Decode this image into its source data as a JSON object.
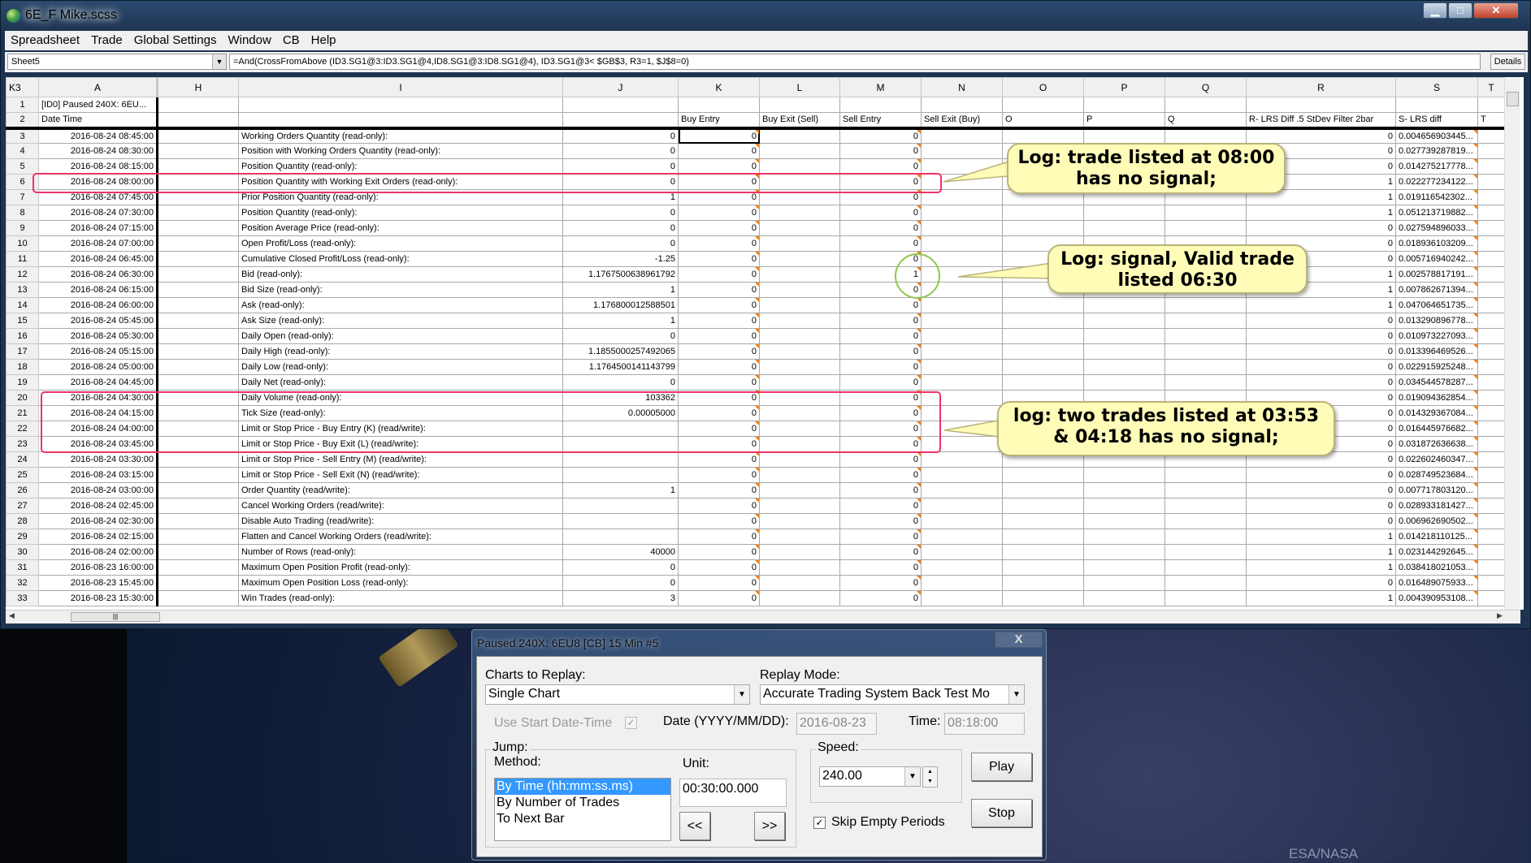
{
  "window": {
    "title": "6E_F Mike.scss",
    "minimize": "▁",
    "maximize": "□",
    "close": "✕"
  },
  "menu": [
    "Spreadsheet",
    "Trade",
    "Global Settings",
    "Window",
    "CB",
    "Help"
  ],
  "formula_bar": {
    "sheet": "Sheet5",
    "formula": "=And(CrossFromAbove (ID3.SG1@3:ID3.SG1@4,ID8.SG1@3:ID8.SG1@4), ID3.SG1@3< $GB$3, R3=1, $J$8=0)",
    "details_label": "Details"
  },
  "grid": {
    "cell_ref": "K3",
    "columns": [
      "A",
      "H",
      "I",
      "J",
      "K",
      "L",
      "M",
      "N",
      "O",
      "P",
      "Q",
      "R",
      "S",
      "T"
    ],
    "row1": {
      "num": "1",
      "A": "[ID0] Paused 240X: 6EU..."
    },
    "row2": {
      "num": "2",
      "A": "Date Time",
      "K": "Buy Entry",
      "L": "Buy Exit (Sell)",
      "M": "Sell Entry",
      "N": "Sell Exit (Buy)",
      "O": "O",
      "P": "P",
      "Q": "Q",
      "R": "R- LRS Diff .5 StDev Filter 2bar",
      "S": "S- LRS diff",
      "T": "T"
    },
    "rows": [
      [
        "3",
        "2016-08-24  08:45:00",
        "Working Orders Quantity (read-only):",
        "0",
        "0",
        "0",
        "0",
        "0.004656903445..."
      ],
      [
        "4",
        "2016-08-24  08:30:00",
        "Position with Working Orders Quantity (read-only):",
        "0",
        "0",
        "0",
        "0",
        "0.027739287819..."
      ],
      [
        "5",
        "2016-08-24  08:15:00",
        "Position Quantity (read-only):",
        "0",
        "0",
        "0",
        "0",
        "0.014275217778..."
      ],
      [
        "6",
        "2016-08-24  08:00:00",
        "Position Quantity with Working Exit Orders (read-only):",
        "0",
        "0",
        "0",
        "1",
        "0.022277234122..."
      ],
      [
        "7",
        "2016-08-24  07:45:00",
        "Prior Position Quantity (read-only):",
        "1",
        "0",
        "0",
        "1",
        "0.019116542302..."
      ],
      [
        "8",
        "2016-08-24  07:30:00",
        "Position Quantity (read-only):",
        "0",
        "0",
        "0",
        "1",
        "0.051213719882..."
      ],
      [
        "9",
        "2016-08-24  07:15:00",
        "Position Average Price (read-only):",
        "0",
        "0",
        "0",
        "0",
        "0.027594896033..."
      ],
      [
        "10",
        "2016-08-24  07:00:00",
        "Open Profit/Loss (read-only):",
        "0",
        "0",
        "0",
        "0",
        "0.018936103209..."
      ],
      [
        "11",
        "2016-08-24  06:45:00",
        "Cumulative Closed Profit/Loss (read-only):",
        "-1.25",
        "0",
        "0",
        "0",
        "0.005716940242..."
      ],
      [
        "12",
        "2016-08-24  06:30:00",
        "Bid (read-only):",
        "1.1767500638961792",
        "0",
        "1",
        "1",
        "0.002578817191..."
      ],
      [
        "13",
        "2016-08-24  06:15:00",
        "Bid Size (read-only):",
        "1",
        "0",
        "0",
        "1",
        "0.007862671394..."
      ],
      [
        "14",
        "2016-08-24  06:00:00",
        "Ask (read-only):",
        "1.176800012588501",
        "0",
        "0",
        "1",
        "0.047064651735..."
      ],
      [
        "15",
        "2016-08-24  05:45:00",
        "Ask Size (read-only):",
        "1",
        "0",
        "0",
        "0",
        "0.013290896778..."
      ],
      [
        "16",
        "2016-08-24  05:30:00",
        "Daily Open (read-only):",
        "0",
        "0",
        "0",
        "0",
        "0.010973227093..."
      ],
      [
        "17",
        "2016-08-24  05:15:00",
        "Daily High (read-only):",
        "1.1855000257492065",
        "0",
        "0",
        "0",
        "0.013396469526..."
      ],
      [
        "18",
        "2016-08-24  05:00:00",
        "Daily Low (read-only):",
        "1.1764500141143799",
        "0",
        "0",
        "0",
        "0.022915925248..."
      ],
      [
        "19",
        "2016-08-24  04:45:00",
        "Daily Net (read-only):",
        "0",
        "0",
        "0",
        "0",
        "0.034544578287..."
      ],
      [
        "20",
        "2016-08-24  04:30:00",
        "Daily Volume (read-only):",
        "103362",
        "0",
        "0",
        "0",
        "0.019094362854..."
      ],
      [
        "21",
        "2016-08-24  04:15:00",
        "Tick Size (read-only):",
        "0.00005000",
        "0",
        "0",
        "0",
        "0.014329367084..."
      ],
      [
        "22",
        "2016-08-24  04:00:00",
        "Limit or Stop Price - Buy Entry (K) (read/write):",
        "",
        "0",
        "0",
        "0",
        "0.016445976682..."
      ],
      [
        "23",
        "2016-08-24  03:45:00",
        "Limit or Stop Price - Buy Exit (L) (read/write):",
        "",
        "0",
        "0",
        "0",
        "0.031872636638..."
      ],
      [
        "24",
        "2016-08-24  03:30:00",
        "Limit or Stop Price - Sell Entry (M) (read/write):",
        "",
        "0",
        "0",
        "0",
        "0.022602460347..."
      ],
      [
        "25",
        "2016-08-24  03:15:00",
        "Limit or Stop Price - Sell Exit (N) (read/write):",
        "",
        "0",
        "0",
        "0",
        "0.028749523684..."
      ],
      [
        "26",
        "2016-08-24  03:00:00",
        "Order Quantity (read/write):",
        "1",
        "0",
        "0",
        "0",
        "0.007717803120..."
      ],
      [
        "27",
        "2016-08-24  02:45:00",
        "Cancel Working Orders (read/write):",
        "",
        "0",
        "0",
        "0",
        "0.028933181427..."
      ],
      [
        "28",
        "2016-08-24  02:30:00",
        "Disable Auto Trading (read/write):",
        "",
        "0",
        "0",
        "0",
        "0.006962690502..."
      ],
      [
        "29",
        "2016-08-24  02:15:00",
        "Flatten and Cancel Working Orders (read/write):",
        "",
        "0",
        "0",
        "1",
        "0.014218110125..."
      ],
      [
        "30",
        "2016-08-24  02:00:00",
        "Number of Rows (read-only):",
        "40000",
        "0",
        "0",
        "1",
        "0.023144292645..."
      ],
      [
        "31",
        "2016-08-23  16:00:00",
        "Maximum Open Position Profit (read-only):",
        "0",
        "0",
        "0",
        "1",
        "0.038418021053..."
      ],
      [
        "32",
        "2016-08-23  15:45:00",
        "Maximum Open Position Loss (read-only):",
        "0",
        "0",
        "0",
        "0",
        "0.016489075933..."
      ],
      [
        "33",
        "2016-08-23  15:30:00",
        "Win Trades (read-only):",
        "3",
        "0",
        "0",
        "1",
        "0.004390953108..."
      ]
    ]
  },
  "annotations": {
    "callout1": {
      "line1": "Log: trade listed at 08:00",
      "line2": "has no signal;"
    },
    "callout2": {
      "line1": "Log: signal, Valid trade",
      "line2": "listed 06:30"
    },
    "callout3": {
      "line1": "log: two trades listed at 03:53",
      "line2": "& 04:18 has no signal;"
    },
    "highlight_color": "#ee3366",
    "circle_color": "#8cc84b",
    "callout_fill": "#fffcb8"
  },
  "replay_dialog": {
    "title": "Paused 240X: 6EU8 [CB]  15 Min   #5",
    "close_label": "X",
    "charts_label": "Charts to Replay:",
    "charts_value": "Single Chart",
    "mode_label": "Replay Mode:",
    "mode_value": "Accurate Trading System Back Test Mo",
    "use_start_label": "Use Start Date-Time",
    "use_start_checked": true,
    "date_label": "Date (YYYY/MM/DD):",
    "date_value": "2016-08-23",
    "time_label": "Time:",
    "time_value": "08:18:00",
    "jump_label": "Jump:",
    "method_label": "Method:",
    "methods": [
      "By Time (hh:mm:ss.ms)",
      "By Number of Trades",
      "To Next Bar"
    ],
    "unit_label": "Unit:",
    "unit_value": "00:30:00.000",
    "back_label": "<<",
    "forward_label": ">>",
    "speed_label": "Speed:",
    "speed_value": "240.00",
    "skip_label": "Skip Empty Periods",
    "skip_checked": true,
    "play_label": "Play",
    "stop_label": "Stop"
  },
  "desktop": {
    "credit": "ESA/NASA"
  }
}
